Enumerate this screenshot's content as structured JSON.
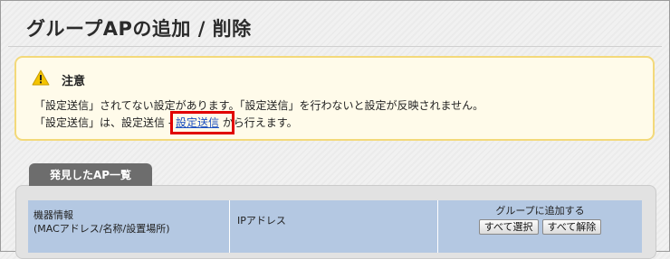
{
  "page": {
    "title": "グループAPの追加 / 削除"
  },
  "notice": {
    "icon": "warning-icon",
    "title": "注意",
    "line1": "「設定送信」されてない設定があります。「設定送信」を行わないと設定が反映されません。",
    "line2_prefix": "「設定送信」は、設定送信 - ",
    "line2_link": "設定送信",
    "line2_suffix": " から行えます。"
  },
  "ap_list": {
    "tab_label": "発見したAP一覧",
    "columns": {
      "device_info_line1": "機器情報",
      "device_info_line2": "(MACアドレス/名称/設置場所)",
      "ip": "IPアドレス",
      "add_to_group": "グループに追加する"
    },
    "select_all_label": "すべて選択",
    "deselect_all_label": "すべて解除"
  },
  "colors": {
    "notice_border": "#f3d97a",
    "notice_background": "#fffbea",
    "highlight": "#e10000",
    "table_header": "#b4c8e2",
    "tab": "#6d6d6d"
  }
}
